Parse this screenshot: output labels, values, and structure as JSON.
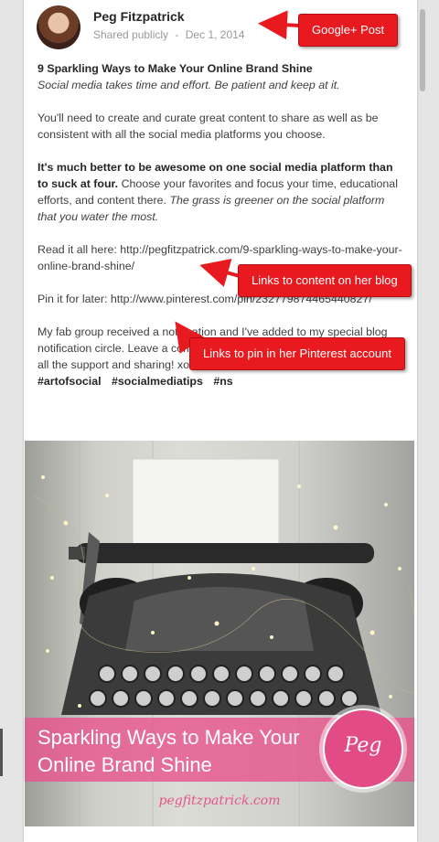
{
  "post": {
    "author": "Peg Fitzpatrick",
    "visibility": "Shared publicly",
    "separator": "-",
    "date": "Dec 1, 2014",
    "title": "9 Sparkling Ways to Make Your Online Brand Shine",
    "subtitle": "Social media takes time and effort. Be patient and keep at it.",
    "para1": "You'll need to create and curate great content to share as well as be consistent with all the social media platforms you choose.",
    "para2_bold": "It's much better to be awesome on one social media platform than to suck at four.",
    "para2_text": " Choose your favorites and focus your time, educational efforts, and content there. ",
    "para2_italic": "The grass is greener on the social platform that you water the most.",
    "read_label": "Read it all here: ",
    "read_link": "http://pegfitzpatrick.com/9-sparkling-ways-to-make-your-online-brand-shine/",
    "pin_label": "Pin it for later: ",
    "pin_link": "http://www.pinterest.com/pin/232779874465440827/",
    "para4": "My fab group received a notification and I've added to my special blog notification circle. Leave a comment asking to be added. Thank you for all the support and sharing! xoxo",
    "hashtags": [
      "#artofsocial",
      "#socialmediatips",
      "#ns"
    ]
  },
  "image": {
    "banner_text": "Sparkling Ways to Make Your Online Brand Shine",
    "badge": "Peg",
    "site": "pegfitzpatrick.com"
  },
  "callouts": {
    "post": "Google+ Post",
    "blog": "Links to content on her blog",
    "pinterest": "Links to pin in her Pinterest account"
  },
  "colors": {
    "callout": "#e8191f",
    "banner": "#e8568c"
  }
}
